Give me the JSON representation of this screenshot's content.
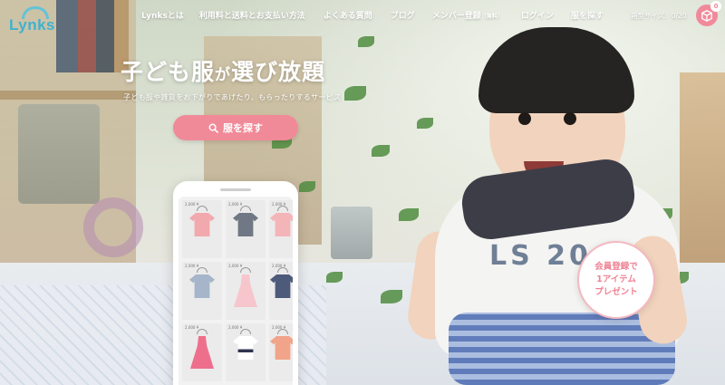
{
  "header": {
    "logo_text": "Lynks",
    "nav": [
      {
        "label": "Lynksとは"
      },
      {
        "label": "利用料と送料とお支払い方法"
      },
      {
        "label": "よくある質問"
      },
      {
        "label": "ブログ"
      },
      {
        "label": "メンバー登録",
        "suffix": "（無料）"
      },
      {
        "label": "ログイン"
      },
      {
        "label": "服を探す"
      }
    ],
    "cart_label": "箱型サイズ：0/20",
    "cart_badge": "0"
  },
  "hero": {
    "title_1": "子ども服",
    "title_2": "が",
    "title_3": "選び放題",
    "subtitle": "子ども服や雑貨をお下がりであげたり、もらったりするサービス",
    "search_button": "服を探す"
  },
  "member_badge": {
    "line1": "会員登録で",
    "line2": "1アイテム",
    "line3": "プレゼント"
  },
  "kid_shirt_print": "LS 20",
  "phone_items": [
    {
      "price": "2,000 ¥",
      "type": "tshirt",
      "color": "#f2a9ae"
    },
    {
      "price": "2,000 ¥",
      "type": "tshirt",
      "color": "#6f7884"
    },
    {
      "price": "2,000 ¥",
      "type": "tshirt",
      "color": "#f3b5b8"
    },
    {
      "price": "2,000 ¥",
      "type": "tshirt",
      "color": "#a6b5c9"
    },
    {
      "price": "2,000 ¥",
      "type": "dress",
      "color": "#f6c6cc"
    },
    {
      "price": "2,000 ¥",
      "type": "tshirt",
      "color": "#4d5a7a"
    },
    {
      "price": "2,000 ¥",
      "type": "dress",
      "color": "#ee6f8c"
    },
    {
      "price": "2,000 ¥",
      "type": "tshirt",
      "color": "#ffffff"
    },
    {
      "price": "2,000 ¥",
      "type": "tshirt",
      "color": "#f1a48a"
    }
  ],
  "colors": {
    "accent_pink": "#f18a98",
    "logo_blue": "#3fb2cf"
  }
}
